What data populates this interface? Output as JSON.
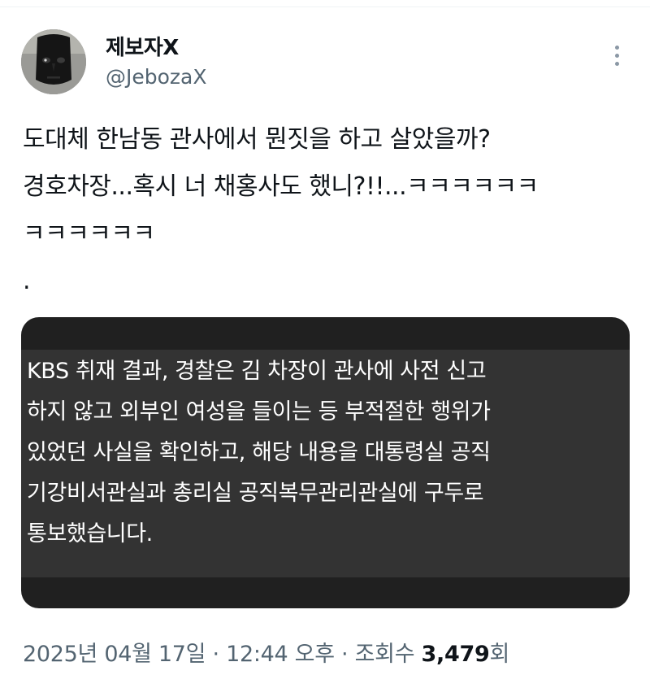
{
  "author": {
    "display_name": "제보자X",
    "handle": "@JebozaX",
    "avatar_icon": "mask-avatar-icon"
  },
  "tweet": {
    "lines": [
      "도대체 한남동 관사에서 뭔짓을 하고 살았을까?",
      "경호차장...혹시 너 채홍사도 했니?!!...ㅋㅋㅋㅋㅋㅋ",
      "ㅋㅋㅋㅋㅋㅋ",
      "."
    ]
  },
  "quote_card": {
    "lines": [
      "KBS 취재 결과, 경찰은 김 차장이 관사에 사전 신고",
      "하지 않고 외부인 여성을 들이는 등 부적절한 행위가",
      "있었던 사실을 확인하고, 해당 내용을 대통령실 공직",
      "기강비서관실과 총리실 공직복무관리관실에 구두로",
      "통보했습니다."
    ]
  },
  "meta": {
    "date": "2025년 04월 17일",
    "separator": " · ",
    "time": "12:44 오후",
    "views_label": "조회수",
    "views_count": "3,479",
    "views_unit": "회"
  },
  "colors": {
    "text": "#0f1419",
    "secondary": "#536471",
    "card_bg": "#202020",
    "card_inner": "#333333"
  }
}
